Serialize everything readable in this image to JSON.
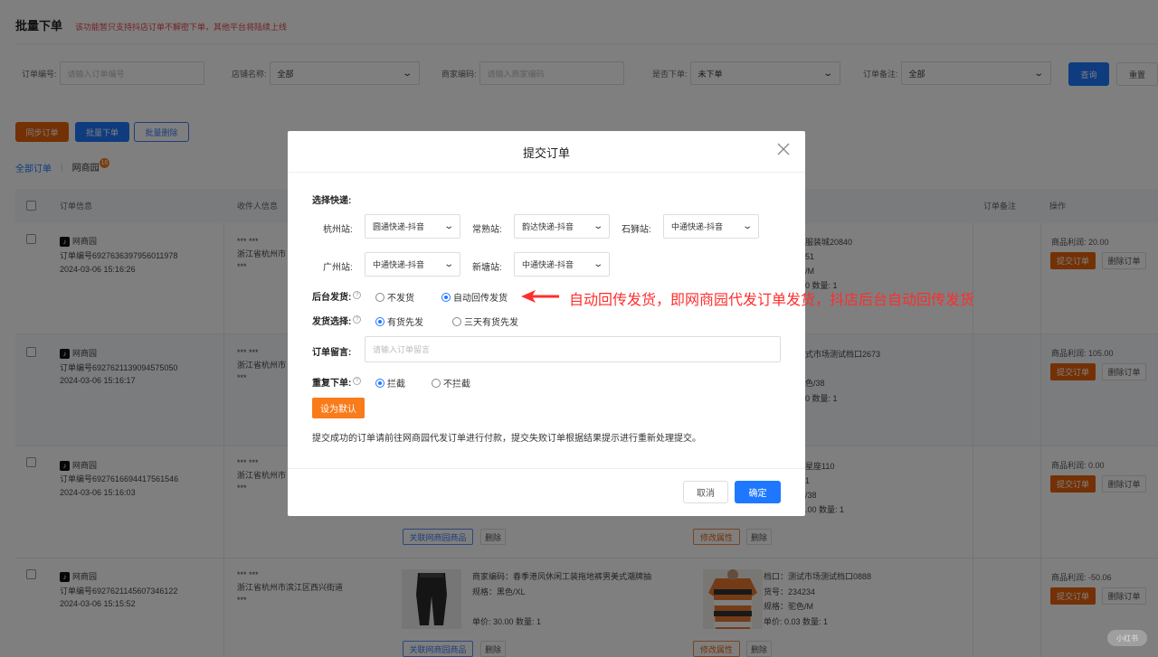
{
  "page": {
    "title": "批量下单",
    "notice": "该功能暂只支持抖店订单不解密下单，其他平台将陆续上线"
  },
  "filters": {
    "order_no_label": "订单编号:",
    "order_no_placeholder": "请输入订单编号",
    "shop_label": "店铺名称:",
    "shop_value": "全部",
    "merchant_code_label": "商家编码:",
    "merchant_code_placeholder": "请输入商家编码",
    "ordered_label": "是否下单:",
    "ordered_value": "未下单",
    "remark_label": "订单备注:",
    "remark_value": "全部",
    "search_btn": "查询",
    "reset_btn": "重置"
  },
  "actions": {
    "sync": "同步订单",
    "batch_order": "批量下单",
    "batch_delete": "批量删除"
  },
  "tabs": {
    "all": "全部订单",
    "wsy": "网商园",
    "wsy_count": "16"
  },
  "table": {
    "headers": {
      "order_info": "订单信息",
      "receiver": "收件人信息",
      "remark": "订单备注",
      "ops": "操作"
    },
    "rows": [
      {
        "shop": "网商园",
        "order_no": "订单编号6927636397956011978",
        "time": "2024-03-06 15:16:26",
        "recv1": "*** ***",
        "recv2": "浙江省杭州市",
        "recv3": "***",
        "right1": "服装城20840",
        "right2": "51",
        "right3": "/M",
        "right4": "0 数量: 1",
        "profit": "商品利润: 20.00"
      },
      {
        "shop": "网商园",
        "order_no": "订单编号6927621139094575050",
        "time": "2024-03-06 15:16:17",
        "recv1": "*** ***",
        "recv2": "浙江省杭州市",
        "recv3": "***",
        "right1": "式市场测试档口2673",
        "right2": "",
        "right3": "色/38",
        "right4": "0 数量: 1",
        "profit": "商品利润: 105.00"
      },
      {
        "shop": "网商园",
        "order_no": "订单编号6927616694417561546",
        "time": "2024-03-06 15:16:03",
        "recv1": "*** ***",
        "recv2": "浙江省杭州市",
        "recv3": "***",
        "right1": "星座110",
        "right2": "1",
        "right3": "/38",
        "right4": ".00 数量: 1",
        "profit": "商品利润: 0.00"
      },
      {
        "shop": "网商园",
        "order_no": "订单编号6927621145607346122",
        "time": "2024-03-06 15:15:52",
        "recv1": "*** ***",
        "recv2": "浙江省杭州市滨江区西兴街道",
        "recv3": "***",
        "prod_code": "商家编码：春季港风休闲工装拖地裤男美式潮牌抽",
        "prod_spec": "规格：黑色/XL",
        "prod_price": "单价: 30.00 数量: 1",
        "stall": "档口：测试市场测试档口0888",
        "item_no": "货号：234234",
        "spec2": "规格：驼色/M",
        "price2": "单价: 0.03 数量: 1",
        "profit": "商品利润: -50.06"
      }
    ],
    "submit_btn": "提交订单",
    "delete_order_btn": "删除订单",
    "link_product_btn": "关联网商园商品",
    "delete_btn": "删除",
    "edit_attr_btn": "修改属性"
  },
  "modal": {
    "title": "提交订单",
    "express_label": "选择快递:",
    "stations": [
      {
        "label": "杭州站:",
        "value": "圆通快递-抖音"
      },
      {
        "label": "常熟站:",
        "value": "韵达快递-抖音"
      },
      {
        "label": "石狮站:",
        "value": "中通快递-抖音"
      },
      {
        "label": "广州站:",
        "value": "中通快递-抖音"
      },
      {
        "label": "新塘站:",
        "value": "中通快递-抖音"
      }
    ],
    "backend_ship_label": "后台发货:",
    "backend_ship_opt1": "不发货",
    "backend_ship_opt2": "自动回传发货",
    "ship_choice_label": "发货选择:",
    "ship_choice_opt1": "有货先发",
    "ship_choice_opt2": "三天有货先发",
    "message_label": "订单留言:",
    "message_placeholder": "请输入订单留言",
    "dup_label": "重复下单:",
    "dup_opt1": "拦截",
    "dup_opt2": "不拦截",
    "default_btn": "设为默认",
    "note": "提交成功的订单请前往网商园代发订单进行付款，提交失败订单根据结果提示进行重新处理提交。",
    "cancel": "取消",
    "confirm": "确定"
  },
  "annotation": "自动回传发货，即网商园代发订单发货，抖店后台自动回传发货",
  "watermark": "小红书"
}
